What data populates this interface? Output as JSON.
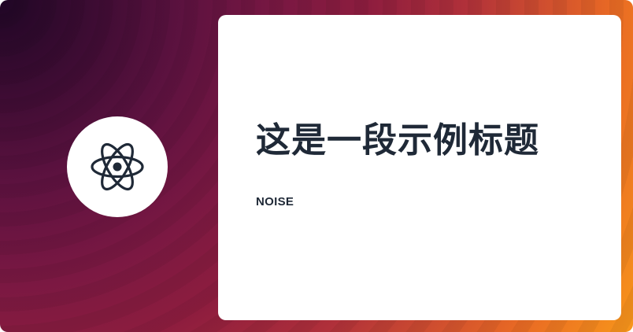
{
  "card": {
    "title": "这是一段示例标题",
    "subtitle": "NOISE"
  },
  "logo": {
    "icon": "atom-icon"
  },
  "colors": {
    "text": "#1f2937",
    "card_background": "#ffffff",
    "gradient_start": "#1f0625",
    "gradient_mid": "#8e1d3e",
    "gradient_end": "#f7941b"
  }
}
